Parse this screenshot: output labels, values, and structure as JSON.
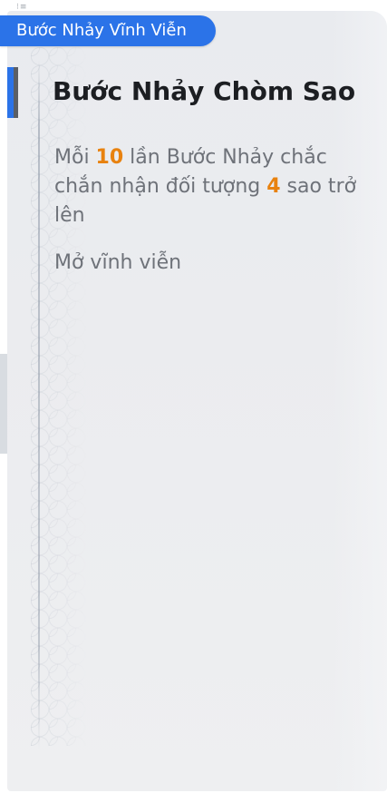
{
  "header": {
    "tab_label": "Bước Nhảy Vĩnh Viễn",
    "top_icon": "list-icon"
  },
  "panel": {
    "title": "Bước Nhảy Chòm Sao",
    "description": {
      "part1": "Mỗi ",
      "count": "10",
      "part2": " lần Bước Nhảy chắc chắn nhận đối tượng ",
      "stars": "4",
      "part3": " sao trở lên"
    },
    "status": "Mở vĩnh viễn"
  },
  "colors": {
    "accent_blue": "#2b73e8",
    "highlight_orange": "#e8820f",
    "text_gray": "#6e7279",
    "title_dark": "#1c1e22"
  }
}
